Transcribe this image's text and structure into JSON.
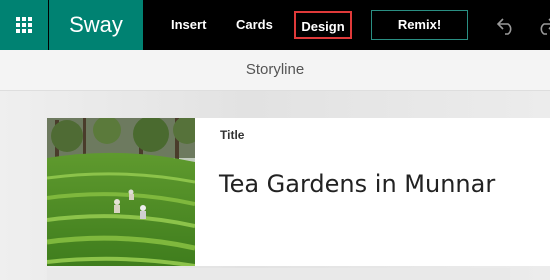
{
  "app": {
    "name": "Sway"
  },
  "menu": {
    "insert": "Insert",
    "cards": "Cards",
    "design": "Design",
    "remix": "Remix!"
  },
  "storyline": {
    "label": "Storyline"
  },
  "card": {
    "label": "Title",
    "title": "Tea Gardens in Munnar"
  },
  "icons": {
    "waffle": "app-launcher-icon",
    "undo": "undo-icon",
    "redo": "redo-icon"
  },
  "colors": {
    "brand": "#008272",
    "topbar": "#000000",
    "highlight": "#e03a3a"
  }
}
